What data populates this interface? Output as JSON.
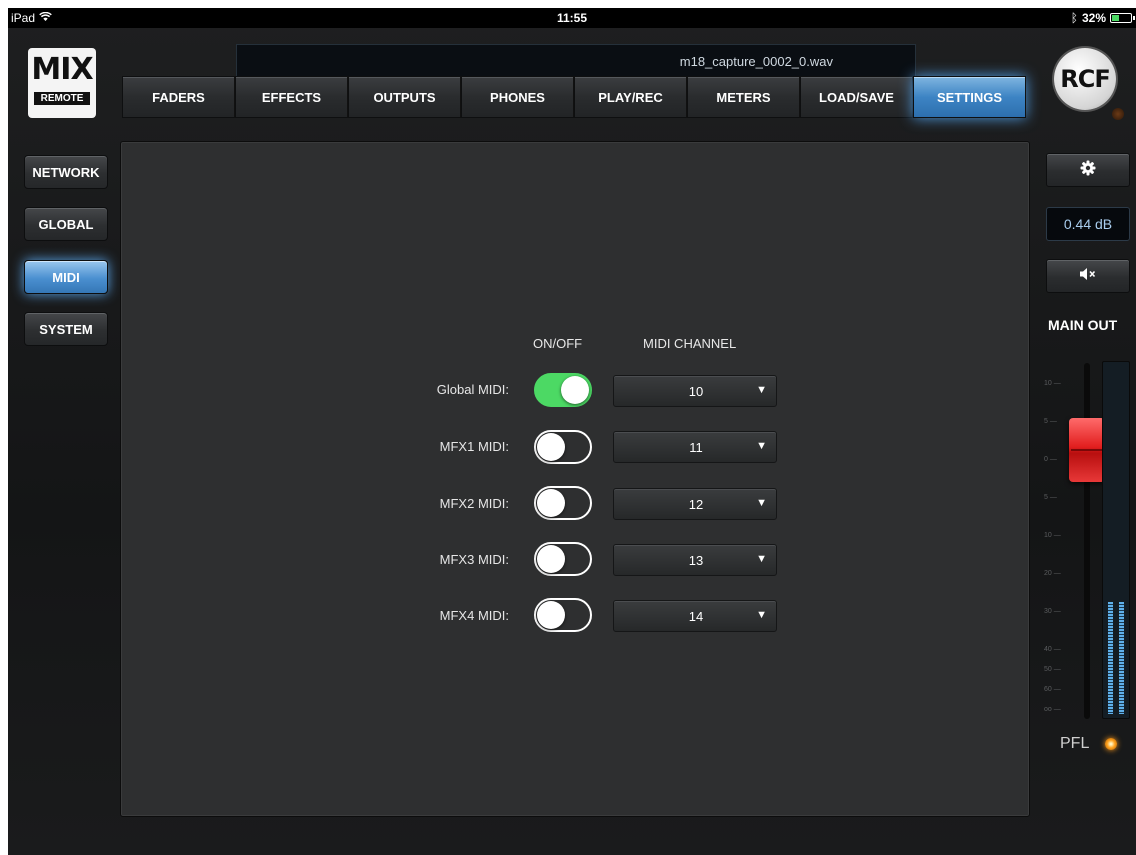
{
  "status_bar": {
    "device": "iPad",
    "time": "11:55",
    "battery": "32%"
  },
  "logos": {
    "mix": "MIX",
    "remote": "REMOTE",
    "rcf": "RCF"
  },
  "file_bar": {
    "file_name": "m18_capture_0002_0.wav"
  },
  "tabs": [
    {
      "label": "FADERS",
      "active": false
    },
    {
      "label": "EFFECTS",
      "active": false
    },
    {
      "label": "OUTPUTS",
      "active": false
    },
    {
      "label": "PHONES",
      "active": false
    },
    {
      "label": "PLAY/REC",
      "active": false
    },
    {
      "label": "METERS",
      "active": false
    },
    {
      "label": "LOAD/SAVE",
      "active": false
    },
    {
      "label": "SETTINGS",
      "active": true
    }
  ],
  "side_menu": [
    {
      "label": "NETWORK",
      "active": false
    },
    {
      "label": "GLOBAL",
      "active": false
    },
    {
      "label": "MIDI",
      "active": true
    },
    {
      "label": "SYSTEM",
      "active": false
    }
  ],
  "midi": {
    "col_onoff": "ON/OFF",
    "col_channel": "MIDI CHANNEL",
    "rows": [
      {
        "label": "Global MIDI:",
        "on": true,
        "channel": "10"
      },
      {
        "label": "MFX1 MIDI:",
        "on": false,
        "channel": "11"
      },
      {
        "label": "MFX2 MIDI:",
        "on": false,
        "channel": "12"
      },
      {
        "label": "MFX3 MIDI:",
        "on": false,
        "channel": "13"
      },
      {
        "label": "MFX4 MIDI:",
        "on": false,
        "channel": "14"
      }
    ]
  },
  "right_panel": {
    "gain": "0.44 dB",
    "title": "MAIN OUT",
    "pfl": "PFL",
    "scale": [
      "10",
      "5",
      "0",
      "5",
      "10",
      "20",
      "30",
      "40",
      "50",
      "60",
      "oo"
    ],
    "fader_level_db": 0.44,
    "meter_level": 0.32
  },
  "colors": {
    "accent": "#4a8fd0",
    "toggle_on": "#4cd964",
    "fader": "#e21f1f",
    "pfl_led": "#ffa21e"
  },
  "icons": {
    "settings": "gear-icon",
    "mute": "speaker-mute-icon",
    "dropdown": "triangle-down-icon"
  }
}
